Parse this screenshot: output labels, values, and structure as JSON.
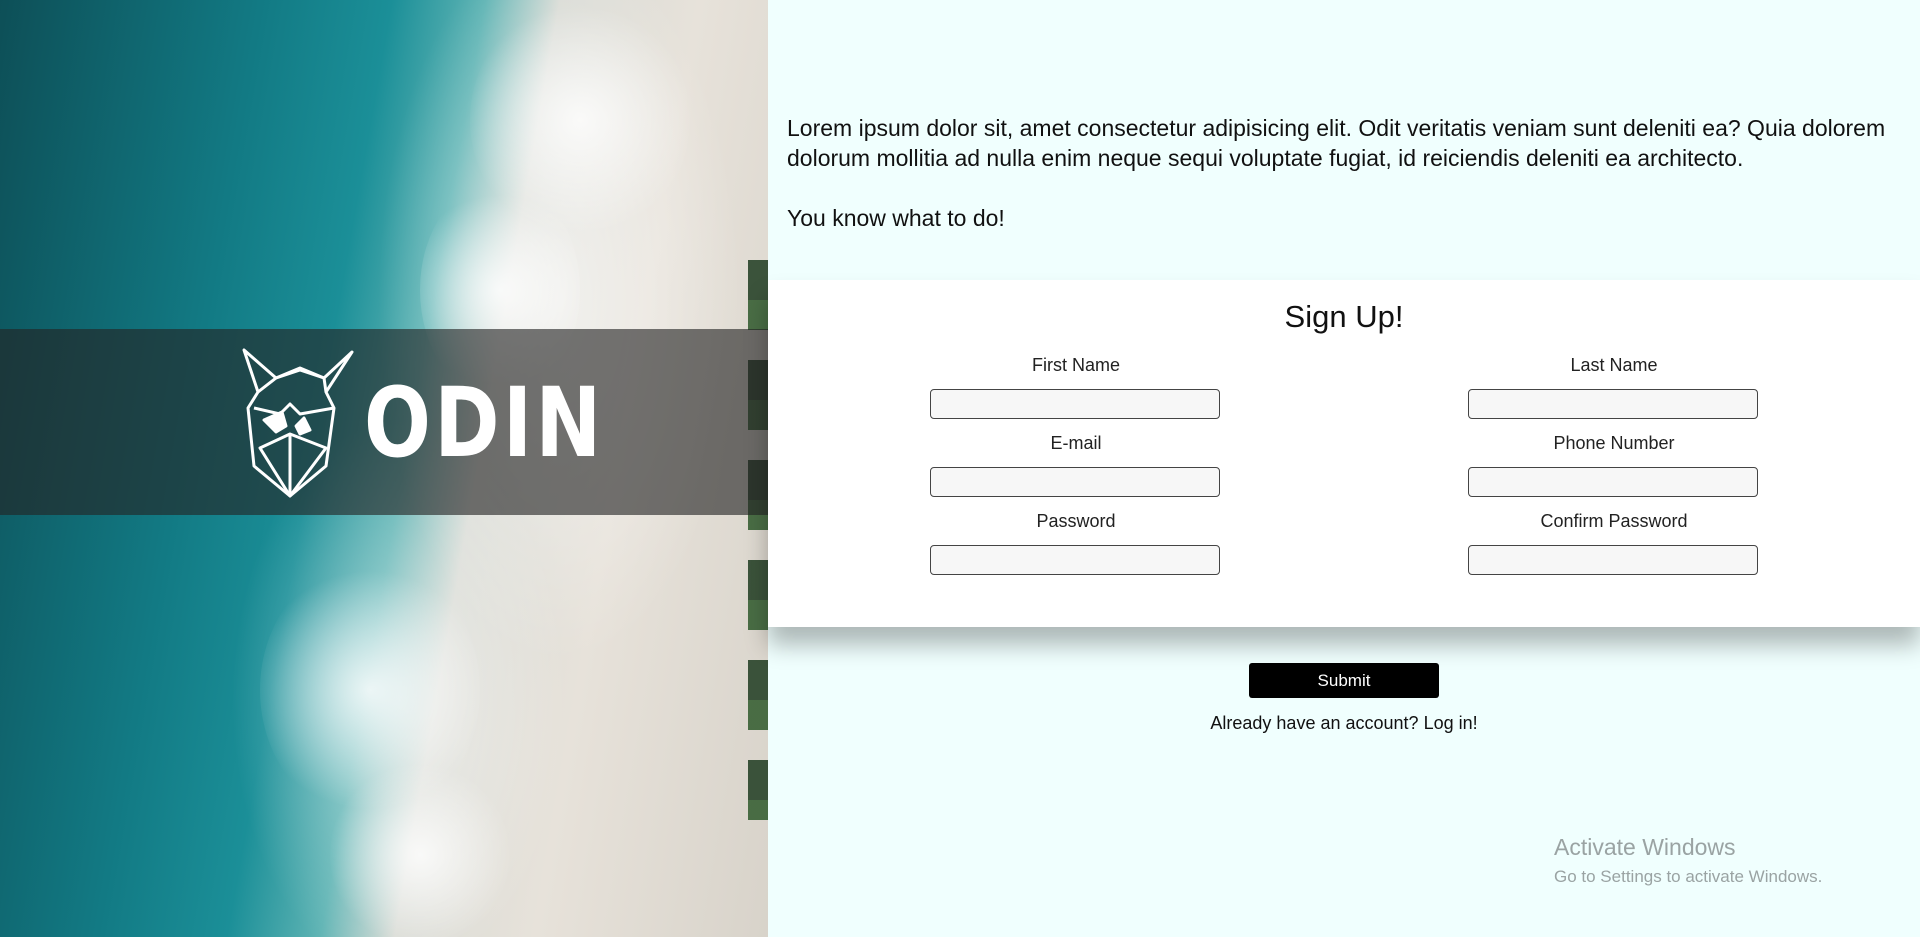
{
  "brand": {
    "logo_text": "ODIN",
    "logo_icon": "viking-helmet-icon"
  },
  "intro": {
    "paragraph": "Lorem ipsum dolor sit, amet consectetur adipisicing elit. Odit veritatis veniam sunt deleniti ea? Quia dolorem dolorum mollitia ad nulla enim neque sequi voluptate fugiat, id reiciendis deleniti ea architecto.",
    "cta": "You know what to do!"
  },
  "form": {
    "title": "Sign Up!",
    "fields": [
      {
        "label": "First Name",
        "value": ""
      },
      {
        "label": "Last Name",
        "value": ""
      },
      {
        "label": "E-mail",
        "value": ""
      },
      {
        "label": "Phone Number",
        "value": ""
      },
      {
        "label": "Password",
        "value": ""
      },
      {
        "label": "Confirm Password",
        "value": ""
      }
    ],
    "submit_label": "Submit"
  },
  "login": {
    "prompt": "Already have an account?",
    "link": "Log in!"
  },
  "watermark": {
    "title": "Activate Windows",
    "subtitle": "Go to Settings to activate Windows."
  },
  "colors": {
    "page_bg": "#f0fffe",
    "card_bg": "#ffffff",
    "button_bg": "#000000"
  }
}
